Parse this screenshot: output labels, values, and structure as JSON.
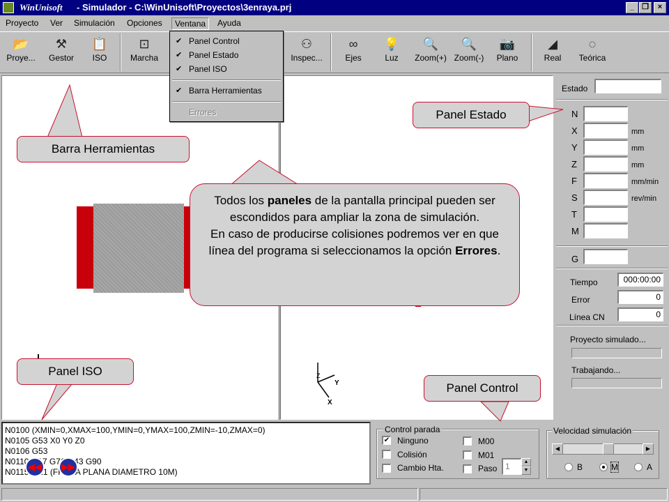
{
  "window": {
    "app_name": "WinUnisoft",
    "title": "- Simulador - C:\\WinUnisoft\\Proyectos\\3enraya.prj",
    "controls": {
      "minimize": "_",
      "maximize": "❐",
      "close": "×"
    }
  },
  "menubar": {
    "items": [
      "Proyecto",
      "Ver",
      "Simulación",
      "Opciones",
      "Ventana",
      "Ayuda"
    ]
  },
  "ventana_menu": {
    "items": [
      {
        "label": "Panel Control",
        "checked": true
      },
      {
        "label": "Panel Estado",
        "checked": true
      },
      {
        "label": "Panel ISO",
        "checked": true
      },
      {
        "label": "Barra Herramientas",
        "checked": true
      },
      {
        "label": "Errores",
        "checked": false,
        "disabled": true
      }
    ],
    "check_glyph": "✔"
  },
  "toolbar": {
    "buttons": [
      {
        "label": "Proye...",
        "icon": "open-folder-icon",
        "glyph": "📂"
      },
      {
        "label": "Gestor",
        "icon": "tools-icon",
        "glyph": "⚒"
      },
      {
        "label": "ISO",
        "icon": "clipboard-icon",
        "glyph": "📋"
      },
      {
        "label": "Marcha",
        "icon": "machine-icon",
        "glyph": "⊡"
      },
      {
        "label": "Inspec...",
        "icon": "binoculars-icon",
        "glyph": "⚇"
      },
      {
        "label": "Ejes",
        "icon": "glasses-icon",
        "glyph": "∞"
      },
      {
        "label": "Luz",
        "icon": "lightbulb-icon",
        "glyph": "💡"
      },
      {
        "label": "Zoom(+)",
        "icon": "zoom-in-icon",
        "glyph": "🔍"
      },
      {
        "label": "Zoom(-)",
        "icon": "zoom-out-icon",
        "glyph": "🔍"
      },
      {
        "label": "Plano",
        "icon": "camera-icon",
        "glyph": "📷"
      },
      {
        "label": "Real",
        "icon": "real-view-icon",
        "glyph": "◢"
      },
      {
        "label": "Teórica",
        "icon": "theoretical-view-icon",
        "glyph": "◌"
      }
    ]
  },
  "estado_panel": {
    "estado_label": "Estado",
    "fields": [
      {
        "label": "N",
        "unit": ""
      },
      {
        "label": "X",
        "unit": "mm"
      },
      {
        "label": "Y",
        "unit": "mm"
      },
      {
        "label": "Z",
        "unit": "mm"
      },
      {
        "label": "F",
        "unit": "mm/min"
      },
      {
        "label": "S",
        "unit": "rev/min"
      },
      {
        "label": "T",
        "unit": ""
      },
      {
        "label": "M",
        "unit": ""
      }
    ],
    "g_label": "G",
    "tiempo_label": "Tiempo",
    "tiempo_value": "000:00:00",
    "error_label": "Error",
    "error_value": "0",
    "linea_label": "Línea CN",
    "linea_value": "0",
    "proyecto_simulado": "Proyecto simulado...",
    "trabajando": "Trabajando..."
  },
  "iso_panel": {
    "lines": [
      "N0100 (XMIN=0,XMAX=100,YMIN=0,YMAX=100,ZMIN=-10,ZMAX=0)",
      "N0105 G53 X0 Y0 Z0",
      "N0106 G53",
      "N0110 G17 G71 G43 G90",
      "N0115 T1.1 (FRESA PLANA DIAMETRO 10M)"
    ]
  },
  "control_panel": {
    "title": "Control parada",
    "options": [
      {
        "label": "Ninguno",
        "checked": true
      },
      {
        "label": "Colisión",
        "checked": false
      },
      {
        "label": "Cambio Hta.",
        "checked": false
      },
      {
        "label": "M00",
        "checked": false
      },
      {
        "label": "M01",
        "checked": false
      },
      {
        "label": "Paso",
        "checked": false
      }
    ],
    "paso_value": "1"
  },
  "velocidad_panel": {
    "title": "Velocidad simulación",
    "slider_level": 0.5,
    "radios": [
      {
        "label": "B",
        "selected": false
      },
      {
        "label": "M",
        "selected": true
      },
      {
        "label": "A",
        "selected": false
      }
    ]
  },
  "axes": {
    "z": "Z",
    "y": "Y",
    "x": "X"
  },
  "callouts": {
    "barra": "Barra Herramientas",
    "estado": "Panel Estado",
    "iso": "Panel ISO",
    "control": "Panel Control",
    "main_line1_a": "Todos los ",
    "main_line1_b": "paneles",
    "main_line1_c": " de la pantalla principal pueden ser escondidos para ampliar la zona de simulación.",
    "main_line2_a": "En caso de producirse colisiones podremos ver en que línea del programa si seleccionamos la opción ",
    "main_line2_b": "Errores",
    "main_line2_c": "."
  },
  "colors": {
    "titlebar": "#000080",
    "workpiece": "#c8000a",
    "workpiece_top": "#a0a0a0",
    "callout_border": "#c8102e"
  }
}
